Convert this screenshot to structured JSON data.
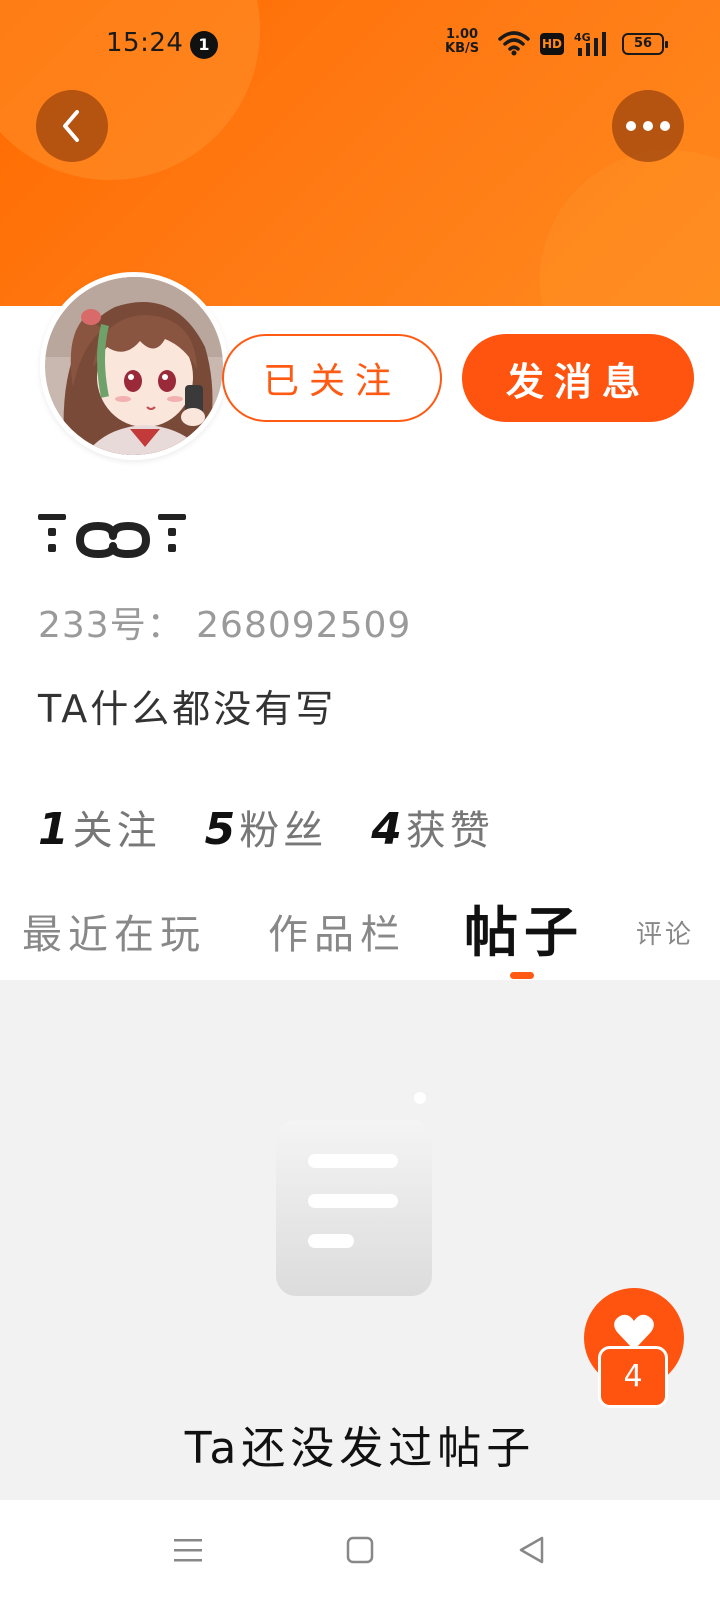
{
  "status_bar": {
    "time": "15:24",
    "notification_count": "1",
    "net_speed_value": "1.00",
    "net_speed_unit": "KB/S",
    "hd_label": "HD",
    "network_type": "4G",
    "battery": "56"
  },
  "header": {
    "back_icon": "chevron-left-icon",
    "more_icon": "more-dots-icon"
  },
  "actions": {
    "follow_label": "已关注",
    "message_label": "发消息"
  },
  "profile": {
    "user_id": "233号： 268092509",
    "bio": "TA什么都没有写"
  },
  "stats": [
    {
      "num": "1",
      "label": "关注"
    },
    {
      "num": "5",
      "label": "粉丝"
    },
    {
      "num": "4",
      "label": "获赞"
    }
  ],
  "tabs": {
    "recent": "最近在玩",
    "works": "作品栏",
    "posts": "帖子",
    "comments": "评论",
    "active": "posts"
  },
  "content": {
    "empty_text": "Ta还没发过帖子"
  },
  "like_fab": {
    "count": "4"
  },
  "colors": {
    "accent": "#ff5310",
    "banner_start": "#ff6a00",
    "banner_end": "#ff8a1e"
  }
}
